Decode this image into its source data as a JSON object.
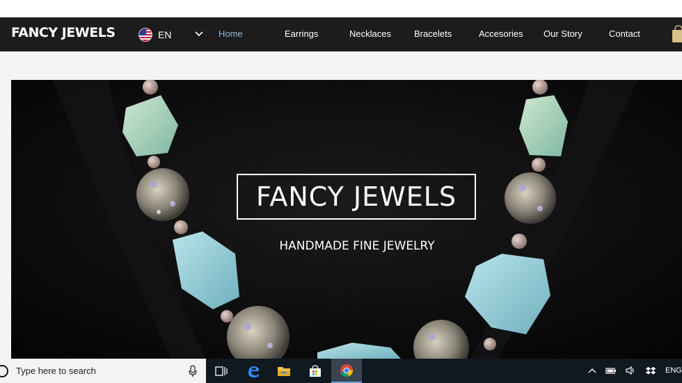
{
  "brand": {
    "logo_text": "FANCY JEWELS"
  },
  "language": {
    "code": "EN",
    "flag_icon": "us-flag-icon"
  },
  "nav": {
    "items": [
      {
        "label": "Home",
        "active": true
      },
      {
        "label": "Earrings"
      },
      {
        "label": "Necklaces"
      },
      {
        "label": "Bracelets"
      },
      {
        "label": "Accesories"
      },
      {
        "label": "Our Story"
      },
      {
        "label": "Contact"
      }
    ],
    "cart_icon": "shopping-bag-icon"
  },
  "hero": {
    "title": "FANCY JEWELS",
    "subtitle": "HANDMADE FINE JEWELRY"
  },
  "taskbar": {
    "search_placeholder": "Type here to search",
    "apps": [
      "task-view-icon",
      "edge-icon",
      "file-explorer-icon",
      "store-icon",
      "chrome-icon"
    ],
    "active_app": "chrome-icon",
    "tray": {
      "language": "ENG"
    }
  },
  "colors": {
    "nav_bg": "#1c1c1c",
    "nav_active": "#8fb9d8",
    "page_bg": "#f4f4f4",
    "taskbar_bg": "#101820"
  }
}
